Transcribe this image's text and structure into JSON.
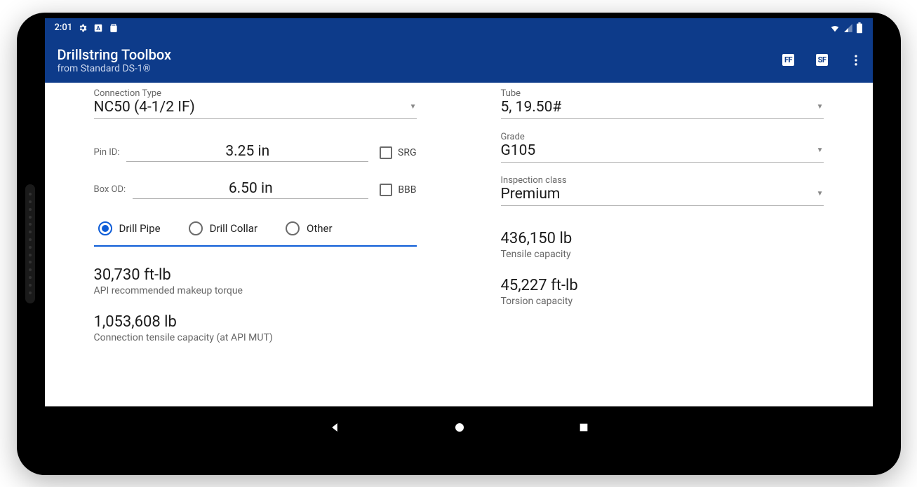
{
  "status": {
    "time": "2:01"
  },
  "app": {
    "title": "Drillstring Toolbox",
    "subtitle": "from Standard DS-1®"
  },
  "actions": {
    "ff": "FF",
    "sf": "SF"
  },
  "left": {
    "connection_type_label": "Connection Type",
    "connection_type_value": "NC50 (4-1/2 IF)",
    "pin_id_label": "Pin ID:",
    "pin_id_value": "3.25 in",
    "srg_label": "SRG",
    "box_od_label": "Box OD:",
    "box_od_value": "6.50 in",
    "bbb_label": "BBB",
    "radios": [
      {
        "label": "Drill Pipe",
        "selected": true
      },
      {
        "label": "Drill Collar",
        "selected": false
      },
      {
        "label": "Other",
        "selected": false
      }
    ],
    "result1_value": "30,730 ft-lb",
    "result1_label": "API recommended makeup torque",
    "result2_value": "1,053,608 lb",
    "result2_label": "Connection tensile capacity (at API MUT)"
  },
  "right": {
    "tube_label": "Tube",
    "tube_value": "5, 19.50#",
    "grade_label": "Grade",
    "grade_value": "G105",
    "class_label": "Inspection class",
    "class_value": "Premium",
    "result1_value": "436,150 lb",
    "result1_label": "Tensile capacity",
    "result2_value": "45,227 ft-lb",
    "result2_label": "Torsion capacity"
  }
}
